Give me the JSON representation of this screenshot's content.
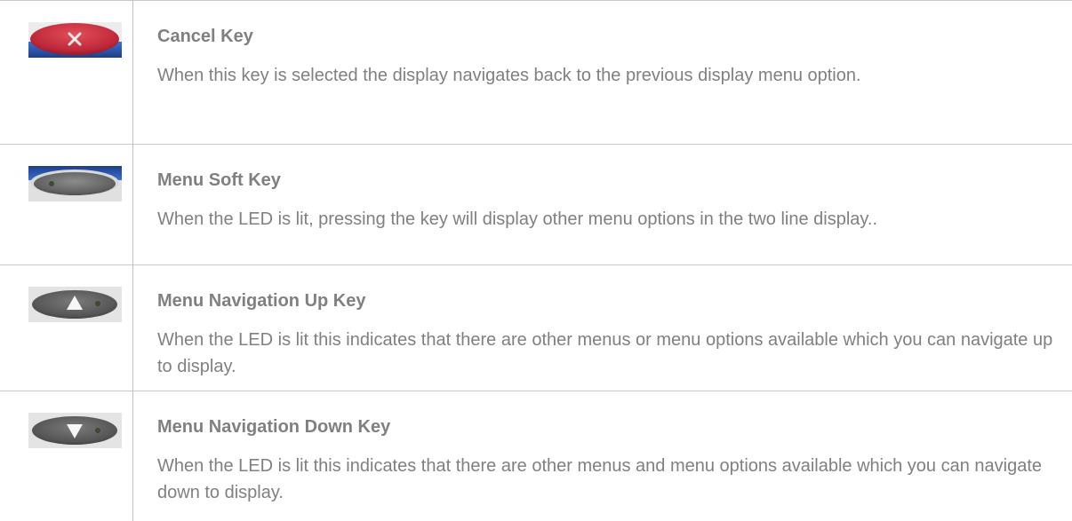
{
  "rows": [
    {
      "icon": "cancel-key-icon",
      "title": "Cancel Key",
      "description": "When this key is selected the display navigates back to the previous display menu option."
    },
    {
      "icon": "menu-soft-key-icon",
      "title": "Menu Soft Key",
      "description": "When the LED is lit, pressing the key will display other menu options in the two line display.."
    },
    {
      "icon": "up-arrow-key-icon",
      "title": "Menu Navigation Up Key",
      "description": "When the LED is lit this indicates that there are other menus or menu options available which you can navigate up to display."
    },
    {
      "icon": "down-arrow-key-icon",
      "title": "Menu Navigation Down Key",
      "description": "When the LED is lit this indicates that there are other menus and menu options available which you can navigate down to display."
    }
  ],
  "colors": {
    "text": "#808080",
    "border": "#c8c8c8",
    "cancel_red": "#c8323c",
    "key_blue": "#2a5ab4",
    "key_grey": "#5a5a5a"
  }
}
